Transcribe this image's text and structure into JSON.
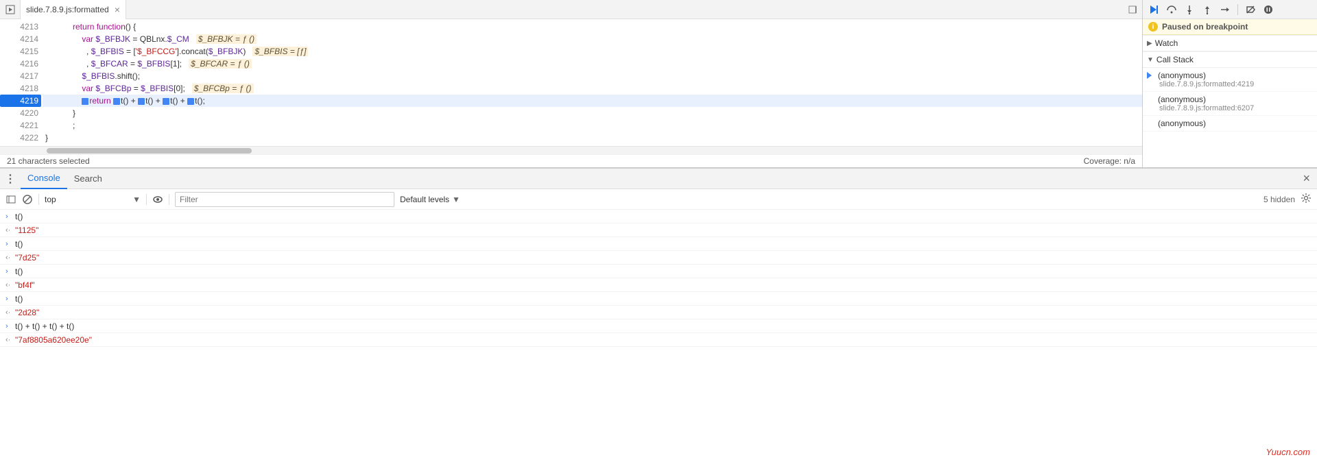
{
  "tab": {
    "title": "slide.7.8.9.js:formatted"
  },
  "code": {
    "line_numbers": [
      "4213",
      "4214",
      "4215",
      "4216",
      "4217",
      "4218",
      "4219",
      "4220",
      "4221",
      "4222"
    ],
    "current_line": "4219",
    "hints": {
      "l4214": "$_BFBJK = ƒ ()",
      "l4215": "$_BFBIS = [ƒ]",
      "l4216": "$_BFCAR = ƒ ()",
      "l4218": "$_BFCBp = ƒ ()"
    },
    "tokens": {
      "l4213_return": "return",
      "l4213_function": "function",
      "l4214_var": "var",
      "l4214_id": "$_BFBJK",
      "l4214_eq": " = QBLnx.",
      "l4214_cm": "$_CM",
      "l4215_id": "$_BFBIS",
      "l4215_eq": " = [",
      "l4215_str": "'$_BFCCG'",
      "l4215_concat": "].concat(",
      "l4215_arg": "$_BFBJK",
      "l4215_close": ")",
      "l4216_id": "$_BFCAR",
      "l4216_eq": " = ",
      "l4216_src": "$_BFBIS",
      "l4216_idx": "[1]",
      "l4217_id": "$_BFBIS",
      "l4217_call": ".shift();",
      "l4218_var": "var",
      "l4218_id": "$_BFCBp",
      "l4218_eq": " = ",
      "l4218_src": "$_BFBIS",
      "l4218_idx": "[0]",
      "l4219_return": "return",
      "l4219_t1": "t",
      "l4219_plus": " + "
    },
    "raw_padding": {
      "p1": "            ",
      "p2": "                ",
      "p3": "                    "
    }
  },
  "status_bar": {
    "selection": "21 characters selected",
    "coverage": "Coverage: n/a"
  },
  "debugger": {
    "paused_label": "Paused on breakpoint",
    "watch_label": "Watch",
    "callstack_label": "Call Stack",
    "stack": [
      {
        "fn": "(anonymous)",
        "loc": "slide.7.8.9.js:formatted:4219"
      },
      {
        "fn": "(anonymous)",
        "loc": "slide.7.8.9.js:formatted:6207"
      },
      {
        "fn": "(anonymous)",
        "loc": ""
      }
    ]
  },
  "console": {
    "tabs": {
      "console": "Console",
      "search": "Search"
    },
    "toolbar": {
      "context": "top",
      "filter_placeholder": "Filter",
      "levels": "Default levels",
      "hidden": "5 hidden"
    },
    "logs": [
      {
        "dir": "in",
        "text": "t()"
      },
      {
        "dir": "out",
        "text": "\"1125\"",
        "string": true
      },
      {
        "dir": "in",
        "text": "t()"
      },
      {
        "dir": "out",
        "text": "\"7d25\"",
        "string": true
      },
      {
        "dir": "in",
        "text": "t()"
      },
      {
        "dir": "out",
        "text": "\"bf4f\"",
        "string": true
      },
      {
        "dir": "in",
        "text": "t()"
      },
      {
        "dir": "out",
        "text": "\"2d28\"",
        "string": true
      },
      {
        "dir": "in",
        "text": "t() + t() + t() + t()"
      },
      {
        "dir": "out",
        "text": "\"7af8805a620ee20e\"",
        "string": true
      }
    ]
  },
  "watermark": "Yuucn.com"
}
